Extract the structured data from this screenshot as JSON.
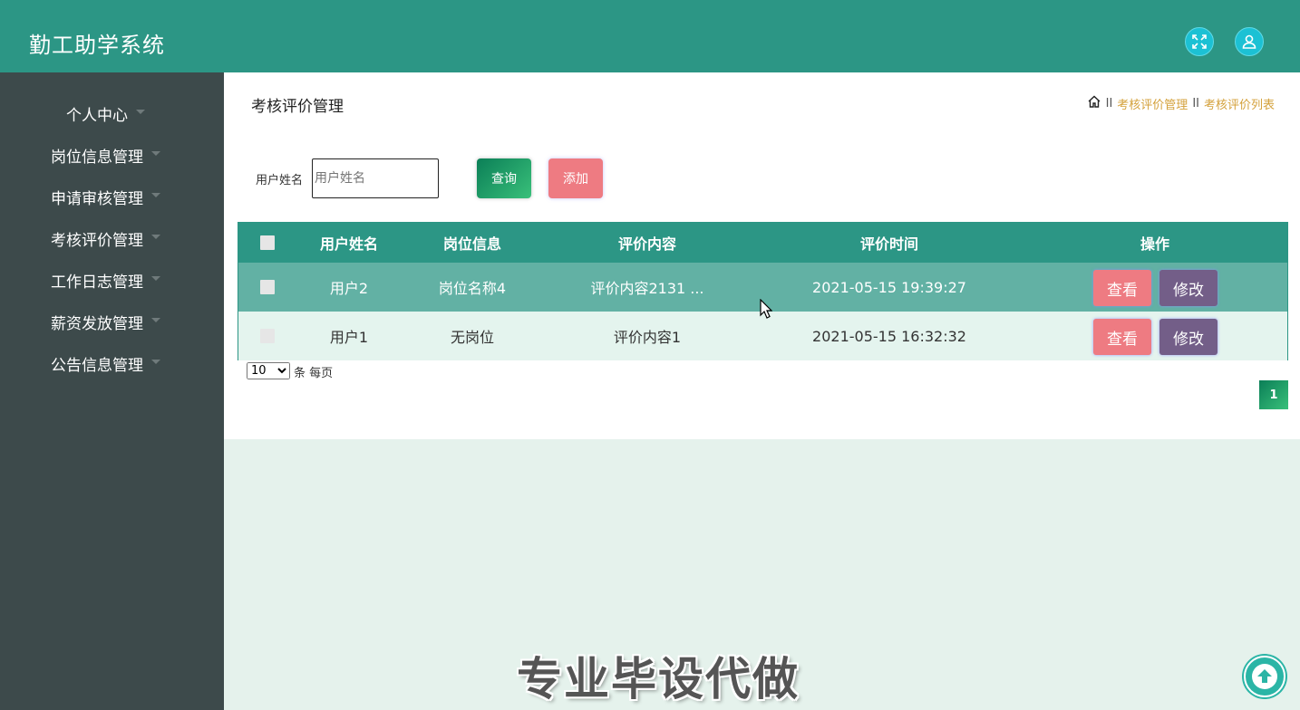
{
  "header": {
    "app_title": "勤工助学系统",
    "icons": [
      "fullscreen-icon",
      "user-icon"
    ],
    "bg_color": "#2c9685"
  },
  "sidebar": {
    "items": [
      {
        "label": "个人中心"
      },
      {
        "label": "岗位信息管理"
      },
      {
        "label": "申请审核管理"
      },
      {
        "label": "考核评价管理"
      },
      {
        "label": "工作日志管理"
      },
      {
        "label": "薪资发放管理"
      },
      {
        "label": "公告信息管理"
      }
    ],
    "bg_color": "#3d4a4b"
  },
  "main": {
    "page_title": "考核评价管理",
    "breadcrumb": {
      "home_icon": "home-icon",
      "separator": "II",
      "items": [
        "考核评价管理",
        "考核评价列表"
      ]
    },
    "search": {
      "label": "用户姓名",
      "placeholder": "用户姓名",
      "value": "",
      "query_label": "查询",
      "add_label": "添加"
    },
    "table": {
      "columns": [
        "用户姓名",
        "岗位信息",
        "评价内容",
        "评价时间",
        "操作"
      ],
      "rows": [
        {
          "user": "用户2",
          "position": "岗位名称4",
          "content": "评价内容2131 ...",
          "time": "2021-05-15 19:39:27",
          "view": "查看",
          "edit": "修改"
        },
        {
          "user": "用户1",
          "position": "无岗位",
          "content": "评价内容1",
          "time": "2021-05-15 16:32:32",
          "view": "查看",
          "edit": "修改"
        }
      ]
    },
    "pagination": {
      "page_size": "10",
      "page_size_options": [
        "10"
      ],
      "per_page_text": "条 每页",
      "current_page": "1"
    }
  },
  "watermark": "专业毕设代做",
  "colors": {
    "accent": "#2c9685",
    "view_button": "#ee7b82",
    "edit_button": "#735e88",
    "breadcrumb_link": "#d4a13b"
  }
}
